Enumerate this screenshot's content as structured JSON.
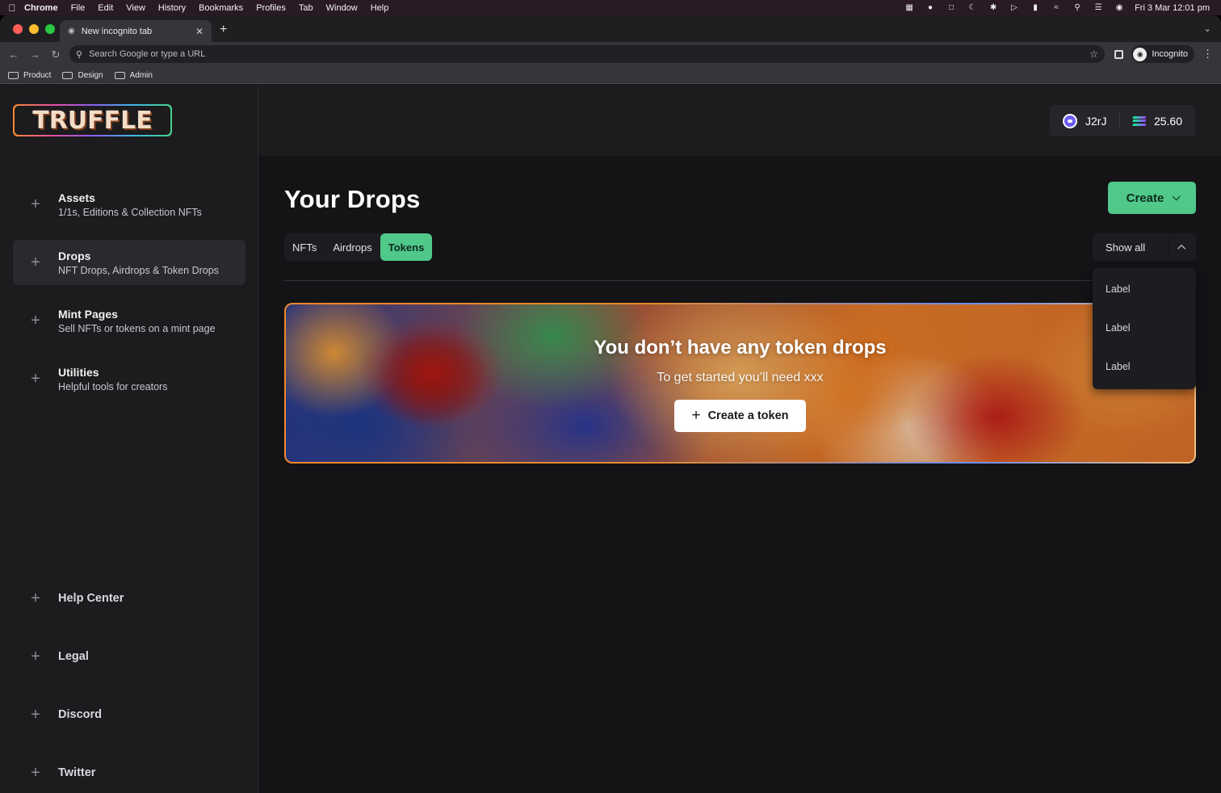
{
  "menubar": {
    "app": "Chrome",
    "items": [
      "File",
      "Edit",
      "View",
      "History",
      "Bookmarks",
      "Profiles",
      "Tab",
      "Window",
      "Help"
    ],
    "clock": "Fri 3 Mar  12:01 pm"
  },
  "browser": {
    "tab_title": "New incognito tab",
    "omnibox_placeholder": "Search Google or type a URL",
    "profile_label": "Incognito",
    "bookmarks": [
      "Product",
      "Design",
      "Admin"
    ]
  },
  "sidebar": {
    "logo": "TRUFFLE",
    "items": [
      {
        "title": "Assets",
        "subtitle": "1/1s, Editions & Collection NFTs"
      },
      {
        "title": "Drops",
        "subtitle": "NFT Drops, Airdrops & Token Drops"
      },
      {
        "title": "Mint Pages",
        "subtitle": "Sell NFTs or tokens on a mint page"
      },
      {
        "title": "Utilities",
        "subtitle": "Helpful tools for creators"
      }
    ],
    "footer_items": [
      "Help Center",
      "Legal",
      "Discord",
      "Twitter"
    ]
  },
  "wallet": {
    "name": "J2rJ",
    "balance": "25.60"
  },
  "main": {
    "title": "Your Drops",
    "create_label": "Create",
    "tabs": [
      "NFTs",
      "Airdrops",
      "Tokens"
    ],
    "active_tab": "Tokens",
    "filter_label": "Show all",
    "filter_options": [
      "Label",
      "Label",
      "Label"
    ],
    "empty_title": "You don’t have any token drops",
    "empty_subtitle": "To get started you’ll need xxx",
    "empty_button": "Create a token"
  }
}
